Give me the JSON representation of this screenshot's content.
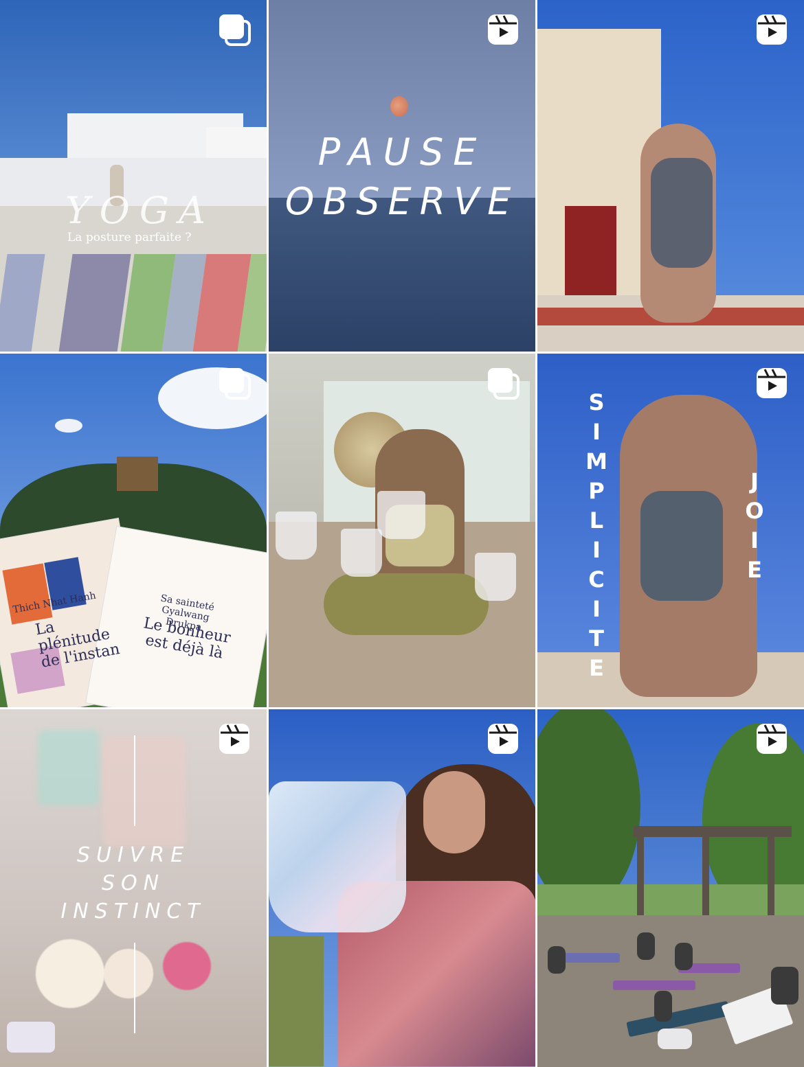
{
  "posts": [
    {
      "type": "carousel",
      "badge": "carousel-icon",
      "overlay": {
        "title": "YOGA",
        "subtitle": "La posture parfaite ?"
      }
    },
    {
      "type": "reel",
      "badge": "reel-icon",
      "overlay": {
        "line1": "PAUSE",
        "line2": "OBSERVE"
      }
    },
    {
      "type": "reel",
      "badge": "reel-icon"
    },
    {
      "type": "carousel",
      "badge": "carousel-icon",
      "books": [
        {
          "author": "Thich Nhat Hanh",
          "title": "La plénitude de l'instan"
        },
        {
          "author": "Sa sainteté Gyalwang Drukpa",
          "title": "Le bonheur est déjà là"
        }
      ]
    },
    {
      "type": "carousel",
      "badge": "carousel-icon"
    },
    {
      "type": "reel",
      "badge": "reel-icon",
      "overlay": {
        "vertical1": "SIMPLICITE",
        "vertical2": "JOIE"
      }
    },
    {
      "type": "reel",
      "badge": "reel-icon",
      "overlay": {
        "line1": "SUIVRE",
        "line2": "SON",
        "line3": "INSTINCT"
      }
    },
    {
      "type": "reel",
      "badge": "reel-icon"
    },
    {
      "type": "reel",
      "badge": "reel-icon"
    }
  ]
}
